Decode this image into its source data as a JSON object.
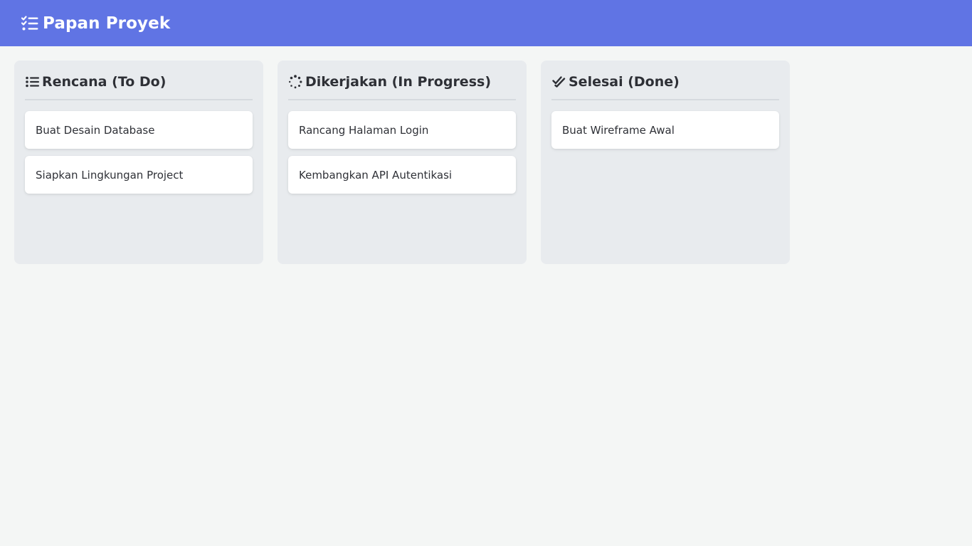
{
  "header": {
    "title": "Papan Proyek",
    "icon": "list-check-icon",
    "background": "#6074e4"
  },
  "columns": [
    {
      "title": "Rencana (To Do)",
      "icon": "list-icon",
      "cards": [
        "Buat Desain Database",
        "Siapkan Lingkungan Project"
      ]
    },
    {
      "title": "Dikerjakan (In Progress)",
      "icon": "spinner-icon",
      "cards": [
        "Rancang Halaman Login",
        "Kembangkan API Autentikasi"
      ]
    },
    {
      "title": "Selesai (Done)",
      "icon": "double-check-icon",
      "cards": [
        "Buat Wireframe Awal"
      ]
    }
  ]
}
